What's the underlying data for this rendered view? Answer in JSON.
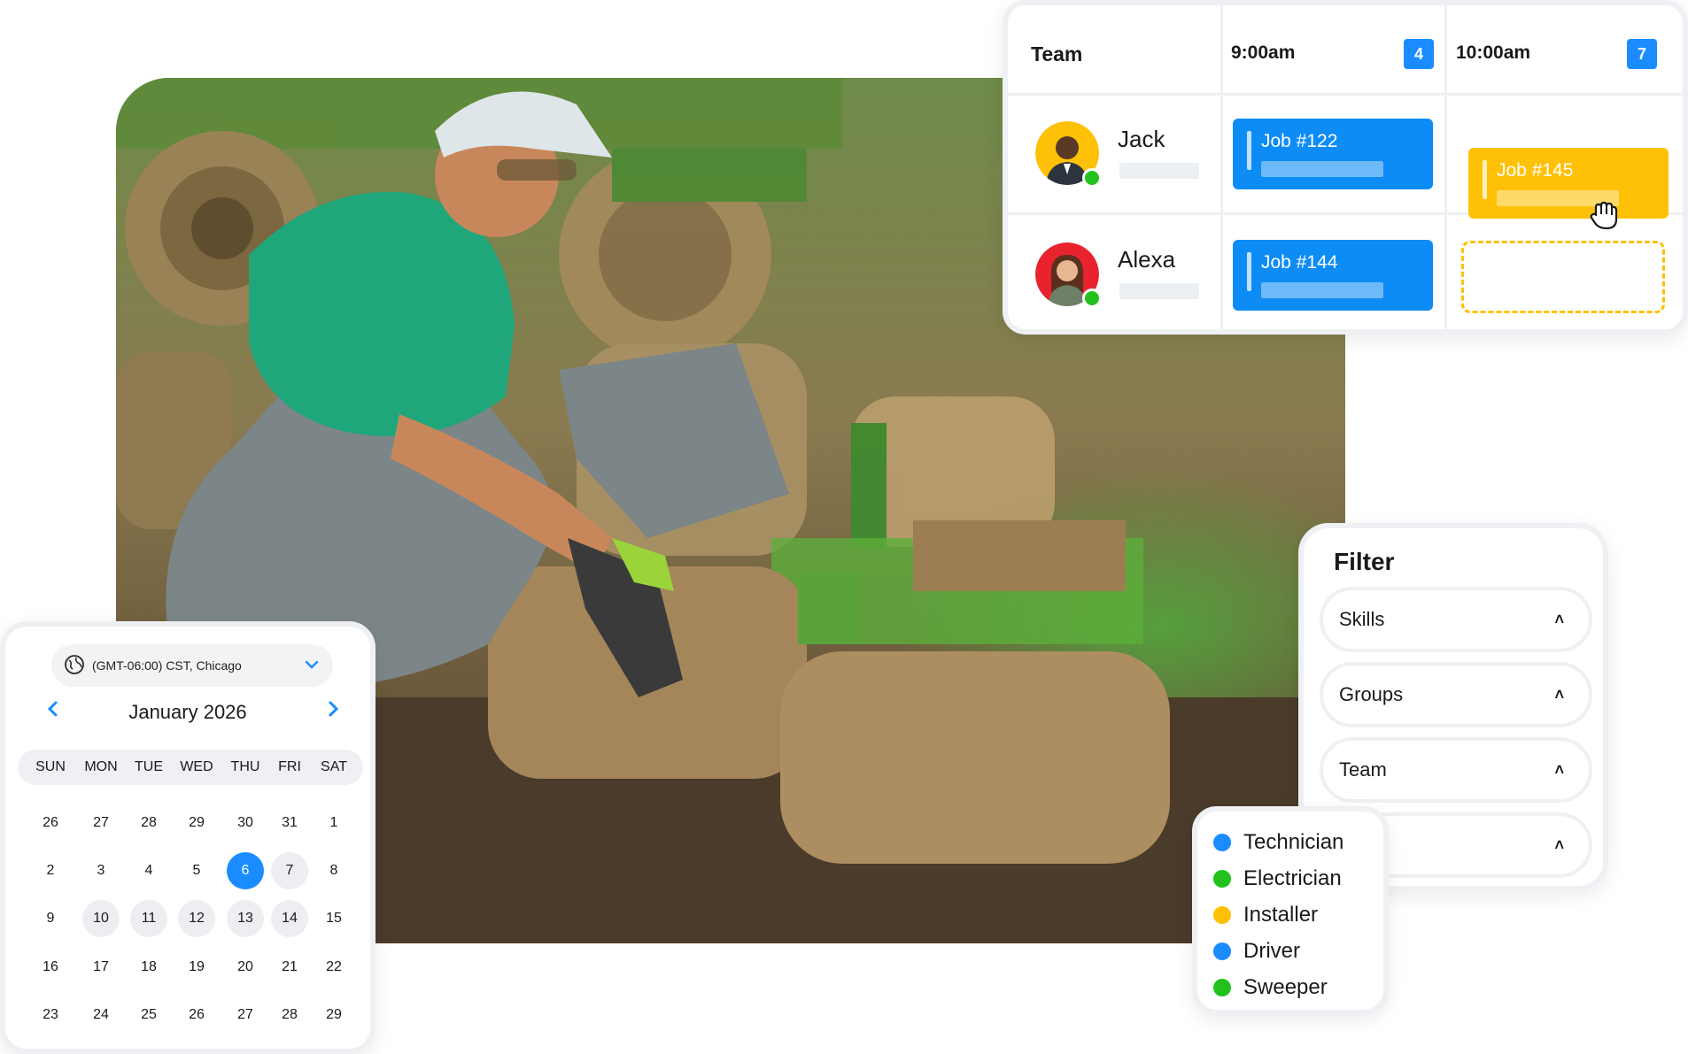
{
  "schedule": {
    "header": "Team",
    "slots": [
      {
        "time": "9:00am",
        "count": "4"
      },
      {
        "time": "10:00am",
        "count": "7"
      }
    ],
    "members": [
      {
        "name": "Jack",
        "job": "Job #122"
      },
      {
        "name": "Alexa",
        "job": "Job #144"
      }
    ],
    "dragging_job": "Job #145"
  },
  "filter": {
    "title": "Filter",
    "rows": [
      "Skills",
      "Groups",
      "Team",
      ""
    ]
  },
  "skills": [
    {
      "label": "Technician",
      "color": "#1a8cff"
    },
    {
      "label": "Electrician",
      "color": "#22c21d"
    },
    {
      "label": "Installer",
      "color": "#fec107"
    },
    {
      "label": "Driver",
      "color": "#1a8cff"
    },
    {
      "label": "Sweeper",
      "color": "#22c21d"
    }
  ],
  "calendar": {
    "timezone": "(GMT-06:00) CST, Chicago",
    "month": "January 2026",
    "weekdays": [
      "SUN",
      "MON",
      "TUE",
      "WED",
      "THU",
      "FRI",
      "SAT"
    ],
    "weeks": [
      [
        "26",
        "27",
        "28",
        "29",
        "30",
        "31",
        "1"
      ],
      [
        "2",
        "3",
        "4",
        "5",
        "6",
        "7",
        "8"
      ],
      [
        "9",
        "10",
        "11",
        "12",
        "13",
        "14",
        "15"
      ],
      [
        "16",
        "17",
        "18",
        "19",
        "20",
        "21",
        "22"
      ],
      [
        "23",
        "24",
        "25",
        "26",
        "27",
        "28",
        "29"
      ]
    ],
    "selected": "6",
    "available": [
      "7",
      "10",
      "11",
      "12",
      "13",
      "14"
    ]
  },
  "colors": {
    "accent_blue": "#1a8cff",
    "accent_yellow": "#fec107",
    "online_green": "#22c21d"
  },
  "icons": [
    "globe-icon",
    "chevron-down-icon",
    "chevron-left-icon",
    "chevron-right-icon",
    "caret-up-icon",
    "grab-hand-icon",
    "online-status-icon"
  ]
}
